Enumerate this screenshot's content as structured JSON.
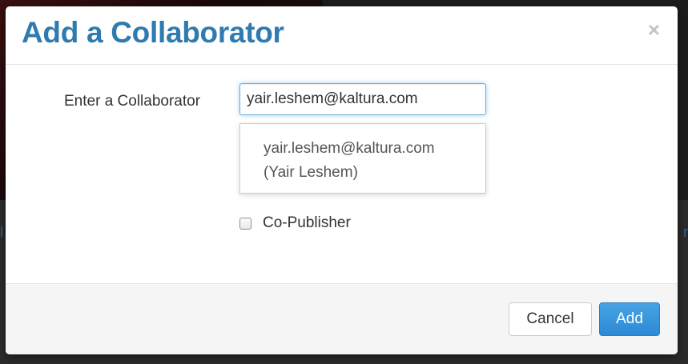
{
  "background": {
    "link_left": "l",
    "link_right": "r"
  },
  "modal": {
    "title": "Add a Collaborator",
    "close_symbol": "×",
    "form": {
      "label": "Enter a Collaborator",
      "input_value": "yair.leshem@kaltura.com"
    },
    "autocomplete": {
      "email": "yair.leshem@kaltura.com",
      "name": "(Yair Leshem)"
    },
    "checkbox": {
      "label": "Co-Publisher",
      "checked": false
    },
    "footer": {
      "cancel_label": "Cancel",
      "add_label": "Add"
    }
  },
  "colors": {
    "title": "#2f7bb0",
    "primary_button": "#2c8ad6",
    "input_focus": "#66afe9"
  }
}
